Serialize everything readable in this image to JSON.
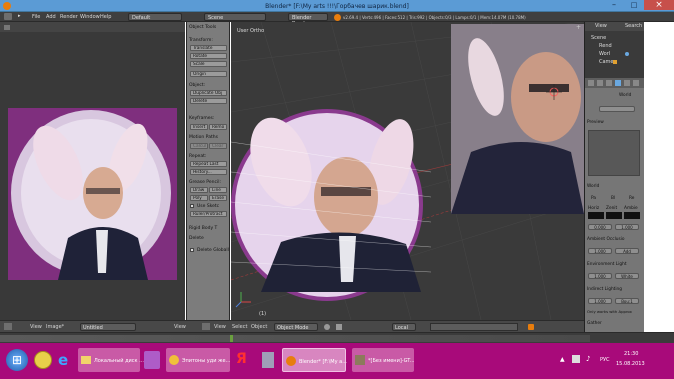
{
  "window": {
    "title": "Blender* [F:\\My arts !!!\\Горбачев шарик.blend]",
    "minimize": "–",
    "maximize": "□",
    "close": "×"
  },
  "infobar": {
    "menus": [
      "File",
      "Add",
      "Render",
      "Window",
      "Help"
    ],
    "layout": "Default",
    "scene": "Scene",
    "engine": "Blender Render",
    "stats": "v2.69.4 | Verts:496 | Faces:512 | Tris:992 | Objects:0/3 | Lamps:0/1 | Mem:14.07M (10.78M)"
  },
  "toolshelf": {
    "header": "Object Tools",
    "transform_header": "Transform:",
    "transform": [
      "Translate",
      "Rotate",
      "Scale"
    ],
    "origin": "Origin",
    "object_header": "Object:",
    "object": [
      "Duplicate Obj",
      "Delete"
    ],
    "keyframes_header": "Keyframes:",
    "insert": "Insert",
    "remove": "Remo",
    "motion_header": "Motion Paths",
    "calculate": "Calcul",
    "clear": "Clear",
    "repeat_header": "Repeat:",
    "repeat": [
      "Repeat Last",
      "History..."
    ],
    "grease_header": "Grease Pencil:",
    "draw": "Draw",
    "line": "Line",
    "poly": "Poly",
    "erase": "Erase",
    "use_sketch": "Use Sketc",
    "ruler": "Ruler/Protract",
    "rigid_body": "Rigid Body T",
    "delete_section": "Delete",
    "delete_global": "Delete Globall"
  },
  "viewport": {
    "label": "User Ortho",
    "frame": "(1)"
  },
  "outliner": {
    "view": "View",
    "search": "Search",
    "items": [
      "Scene",
      "RenderLayers",
      "World",
      "Camera"
    ],
    "item_short": [
      "Scene",
      "Rend",
      "Worl",
      "Came"
    ]
  },
  "properties": {
    "world_name": "World",
    "preview": "Preview",
    "world_section": "World",
    "paper": "Pa",
    "blend": "Bl",
    "real": "Re",
    "horiz": "Horiz",
    "zenith": "Zenit",
    "ambient": "Ambie",
    "exposure": "0.000",
    "range": "1.000",
    "ambient_occlusion": "Ambient Occlusio",
    "ao_value": "1.000",
    "ao_mode": "Add",
    "environment": "Environment Light",
    "env_value": "1.000",
    "env_mode": "White",
    "indirect": "Indirect Lighting",
    "ind_value": "1.000",
    "bounces": "Bou:1",
    "only_note": "Only works with Approx",
    "gather": "Gather",
    "raytrace": "Raytrace",
    "approximate": "Approximate"
  },
  "bottombar": {
    "view_left": "View",
    "image_left": "Image*",
    "untitled": "Untitled",
    "view_right": "View",
    "view_vp": "View",
    "select": "Select",
    "object": "Object",
    "mode": "Object Mode",
    "pivot": "Local"
  },
  "taskbar": {
    "start": "⊞",
    "tasks": [
      {
        "label": "Локальный диск ...",
        "color": "#c95aa6"
      },
      {
        "label": "Эпитоны уди же...",
        "color": "#c95aa6"
      },
      {
        "label": "Blender* [F:\\My a...",
        "color": "#d886c0"
      },
      {
        "label": "*[Без имени]-GT...",
        "color": "#c95aa6"
      }
    ],
    "lang": "РУС",
    "time": "21:30",
    "date": "15.08.2013"
  },
  "colors": {
    "accent": "#5b9bd5",
    "taskbar": "#a80a7a",
    "purple_bg": "#7f2f7e"
  }
}
